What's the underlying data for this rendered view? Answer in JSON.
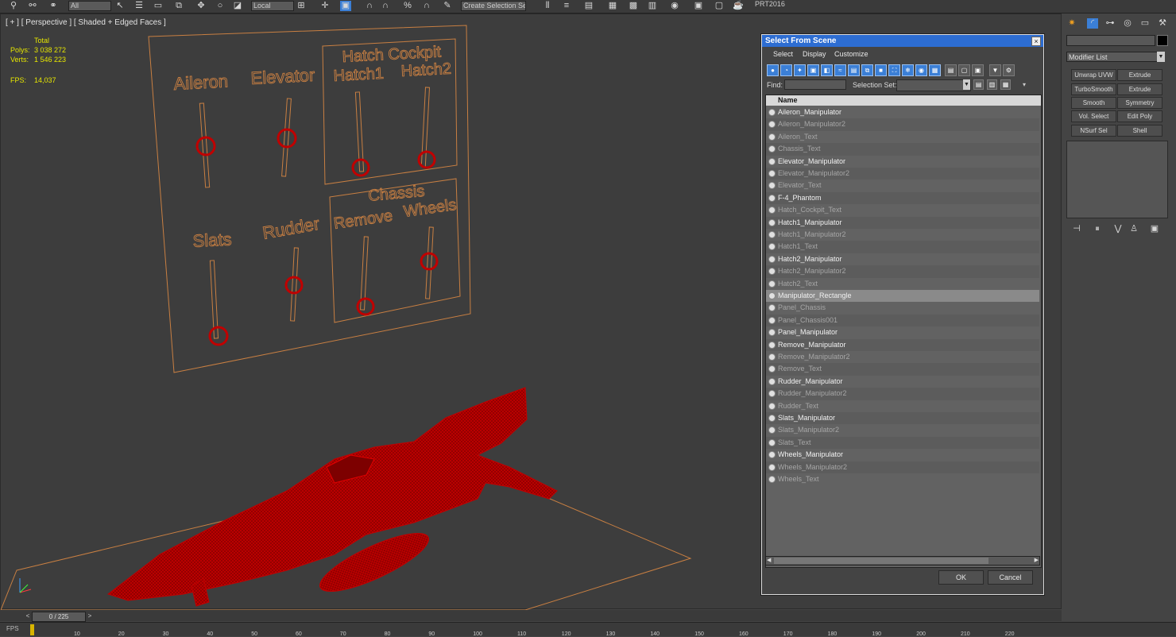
{
  "toolbar": {
    "tag": "PRT2016",
    "view_dropdown": "All",
    "coord_dropdown": "Local",
    "selection_set": "Create Selection Se",
    "icons": [
      "link-icon",
      "unlink-icon",
      "bind-icon",
      "filter-icon",
      "select-icon",
      "region-icon",
      "window-icon",
      "move-icon",
      "rotate-icon",
      "scale-icon",
      "snap-icon",
      "mirror-icon",
      "align-icon",
      "layer-icon",
      "render-icon"
    ]
  },
  "viewport": {
    "label": "[ + ] [ Perspective ] [ Shaded + Edged Faces ]",
    "stats": {
      "total_header": "Total",
      "polys_label": "Polys:",
      "polys_value": "3 038 272",
      "verts_label": "Verts:",
      "verts_value": "1 546 223",
      "fps_label": "FPS:",
      "fps_value": "14,037"
    },
    "panel_labels": [
      "Aileron",
      "Elevator",
      "Hatch Cockpit",
      "Hatch1",
      "Hatch2",
      "Slats",
      "Rudder",
      "Chassis",
      "Remove",
      "Wheels"
    ],
    "accent_color": "#c87f42",
    "model_color": "#b30000"
  },
  "dialog": {
    "title": "Select From Scene",
    "close": "×",
    "menu": [
      "Select",
      "Display",
      "Customize"
    ],
    "find_label": "Find:",
    "find_value": "",
    "selection_set_label": "Selection Set:",
    "column_header": "Name",
    "items": [
      {
        "name": "Aileron_Manipulator",
        "style": "white"
      },
      {
        "name": "Aileron_Manipulator2",
        "style": "grey"
      },
      {
        "name": "Aileron_Text",
        "style": "grey"
      },
      {
        "name": "Chassis_Text",
        "style": "grey"
      },
      {
        "name": "Elevator_Manipulator",
        "style": "white"
      },
      {
        "name": "Elevator_Manipulator2",
        "style": "grey"
      },
      {
        "name": "Elevator_Text",
        "style": "grey"
      },
      {
        "name": "F-4_Phantom",
        "style": "white"
      },
      {
        "name": "Hatch_Cockpit_Text",
        "style": "grey"
      },
      {
        "name": "Hatch1_Manipulator",
        "style": "white"
      },
      {
        "name": "Hatch1_Manipulator2",
        "style": "grey"
      },
      {
        "name": "Hatch1_Text",
        "style": "grey"
      },
      {
        "name": "Hatch2_Manipulator",
        "style": "white"
      },
      {
        "name": "Hatch2_Manipulator2",
        "style": "grey"
      },
      {
        "name": "Hatch2_Text",
        "style": "grey"
      },
      {
        "name": "Manipulator_Rectangle",
        "style": "selected"
      },
      {
        "name": "Panel_Chassis",
        "style": "grey"
      },
      {
        "name": "Panel_Chassis001",
        "style": "grey"
      },
      {
        "name": "Panel_Manipulator",
        "style": "white"
      },
      {
        "name": "Remove_Manipulator",
        "style": "white"
      },
      {
        "name": "Remove_Manipulator2",
        "style": "grey"
      },
      {
        "name": "Remove_Text",
        "style": "grey"
      },
      {
        "name": "Rudder_Manipulator",
        "style": "white"
      },
      {
        "name": "Rudder_Manipulator2",
        "style": "grey"
      },
      {
        "name": "Rudder_Text",
        "style": "grey"
      },
      {
        "name": "Slats_Manipulator",
        "style": "white"
      },
      {
        "name": "Slats_Manipulator2",
        "style": "grey"
      },
      {
        "name": "Slats_Text",
        "style": "grey"
      },
      {
        "name": "Wheels_Manipulator",
        "style": "white"
      },
      {
        "name": "Wheels_Manipulator2",
        "style": "grey"
      },
      {
        "name": "Wheels_Text",
        "style": "grey"
      }
    ],
    "ok_label": "OK",
    "cancel_label": "Cancel",
    "title_color": "#2d6dd2"
  },
  "command_panel": {
    "modifier_list": "Modifier List",
    "buttons": [
      "Unwrap UVW",
      "Extrude",
      "TurboSmooth",
      "Extrude",
      "Smooth",
      "Symmetry",
      "Vol. Select",
      "Edit Poly",
      "NSurf Sel",
      "Shell"
    ]
  },
  "timeline": {
    "frame": "0 / 225",
    "ticks": [
      "10",
      "20",
      "30",
      "40",
      "50",
      "60",
      "70",
      "80",
      "90",
      "100",
      "110",
      "120",
      "130",
      "140",
      "150",
      "160",
      "170",
      "180",
      "190",
      "200",
      "210",
      "220"
    ]
  },
  "bottom_left": "FPS"
}
